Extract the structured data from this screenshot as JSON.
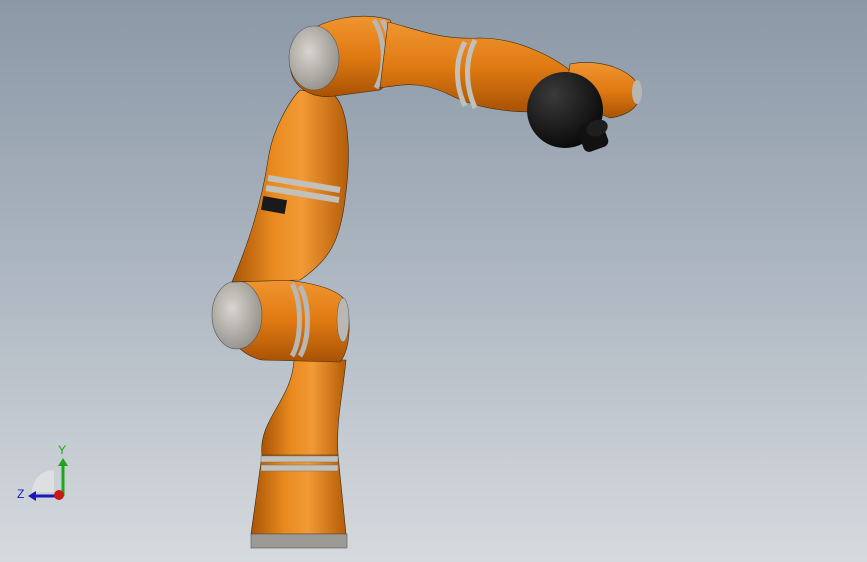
{
  "viewport": {
    "background_top": "#8b98a6",
    "background_bottom": "#d6dade"
  },
  "robot": {
    "body_color": "#e07a12",
    "joint_cap_color": "#bdbab4",
    "ring_color": "#b9b7b3",
    "tool_color": "#0c0c0c"
  },
  "triad": {
    "y_label": "Y",
    "z_label": "Z",
    "y_color": "#1aa81a",
    "z_color": "#1a1ab8",
    "x_color": "#c81818"
  }
}
